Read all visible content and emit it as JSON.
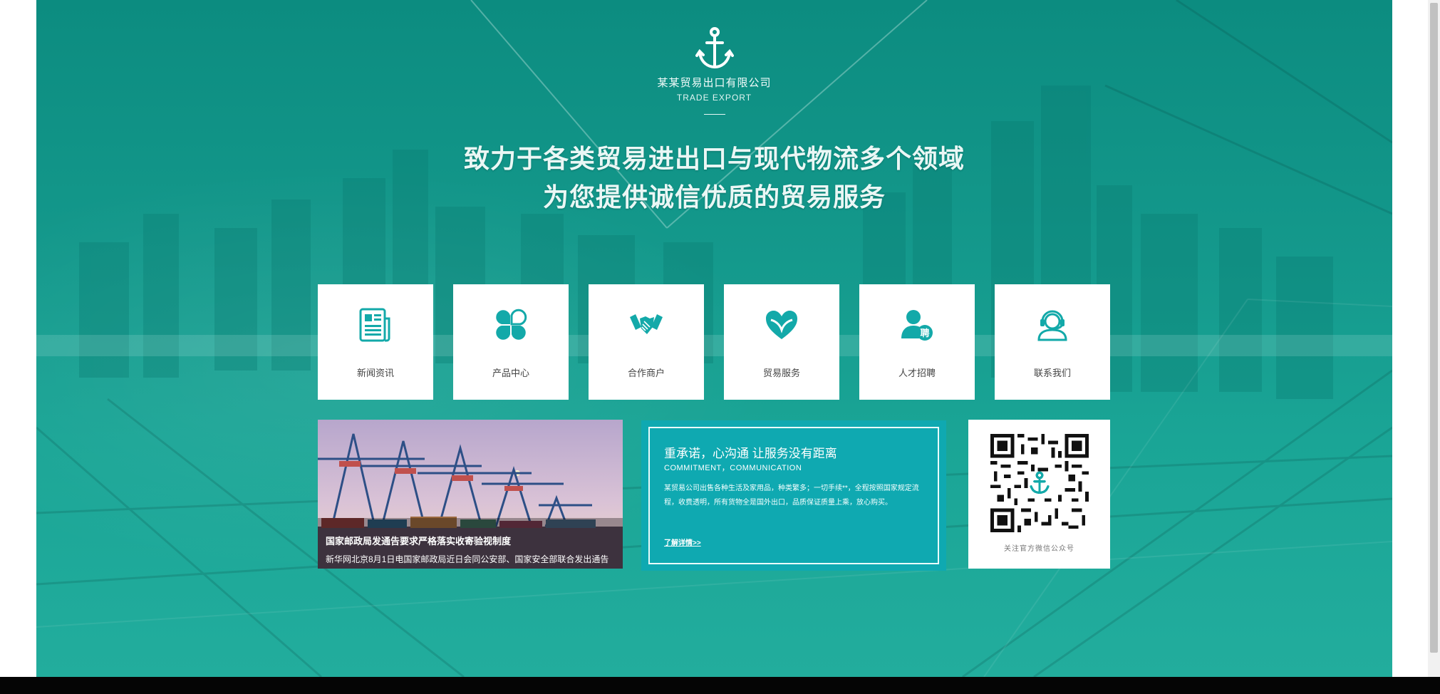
{
  "brand": {
    "name": "某某贸易出口有限公司",
    "tagline_en": "TRADE EXPORT",
    "logo_icon": "anchor-icon"
  },
  "hero": {
    "slogan_line1": "致力于各类贸易进出口与现代物流多个领域",
    "slogan_line2": "为您提供诚信优质的贸易服务"
  },
  "nav_tiles": [
    {
      "label": "新闻资讯",
      "icon": "newspaper-icon"
    },
    {
      "label": "产品中心",
      "icon": "clover-icon"
    },
    {
      "label": "合作商户",
      "icon": "handshake-icon"
    },
    {
      "label": "贸易服务",
      "icon": "heart-icon"
    },
    {
      "label": "人才招聘",
      "icon": "recruit-icon"
    },
    {
      "label": "联系我们",
      "icon": "headset-icon"
    }
  ],
  "news": {
    "title": "国家邮政局发通告要求严格落实收寄验视制度",
    "summary": "新华网北京8月1日电国家邮政局近日会同公安部、国家安全部联合发出通告"
  },
  "commitment": {
    "title": "重承诺，心沟通  让服务没有距离",
    "title_en": "COMMITMENT，COMMUNICATION",
    "body": "某贸易公司出售各种生活及家用品，种类繁多；一切手续**，全程按照国家规定流程，收费透明，所有货物全是国外出口，品质保证质量上乘，放心购买。",
    "link": "了解详情>>"
  },
  "qr": {
    "caption": "关注官方微信公众号"
  },
  "colors": {
    "hero_teal": "#14998c",
    "accent_cyan": "#0fa9b1",
    "icon_teal": "#13a9a9"
  }
}
